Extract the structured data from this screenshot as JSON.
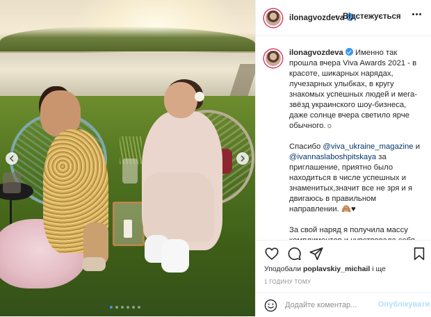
{
  "post": {
    "username": "ilonagvozdeva",
    "follow_label": "Відстежується",
    "bullet": "•",
    "caption": {
      "username": "ilonagvozdeva",
      "p1": "Именно так прошла вчера Viva Awards 2021 - в красоте, шикарных нарядах, лучезарных улыбках, в кругу знакомых успешных людей и мега-звёзд украинского шоу-бизнеса, даже солнце вчера светило ярче обычного.☼",
      "p2_before": "Спасибо ",
      "mention1": "@viva_ukraine_magazine",
      "p2_mid": " и ",
      "mention2": "@ivannaslaboshpitskaya",
      "p2_after": " за приглашение, приятно было находиться в числе успешных и знаменитых,значит все не зря и я двигаюсь в правильном направлении. 🙈♥",
      "p3": "За свой наряд я получила массу комплиментов и чувствовала себя"
    },
    "likes_prefix": "Уподобали ",
    "likes_user": "poplavskiy_michail",
    "likes_suffix": " і ще",
    "time_ago": "1 ГОДИНУ ТОМУ",
    "comment_placeholder": "Додайте коментар...",
    "publish_label": "Опублікувати"
  },
  "carousel": {
    "dot_count": 6,
    "active_dot": 0
  },
  "colors": {
    "accent": "#3897f0",
    "publish_disabled": "#b2dffc"
  },
  "icons": [
    "heart-icon",
    "comment-icon",
    "share-icon",
    "bookmark-icon",
    "emoji-icon",
    "more-icon",
    "verified-icon",
    "chevron-left-icon",
    "chevron-right-icon"
  ]
}
